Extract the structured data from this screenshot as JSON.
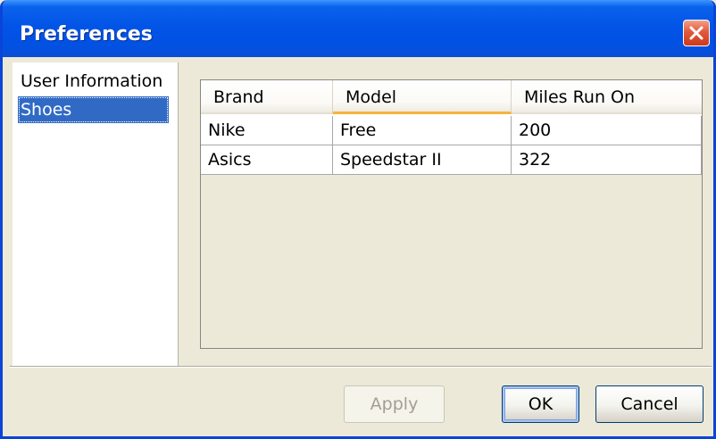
{
  "window": {
    "title": "Preferences",
    "close_icon": "close-icon"
  },
  "sidebar": {
    "items": [
      {
        "label": "User Information",
        "selected": false
      },
      {
        "label": "Shoes",
        "selected": true
      }
    ]
  },
  "table": {
    "columns": [
      "Brand",
      "Model",
      "Miles Run On"
    ],
    "sorted_column": "Model",
    "rows": [
      [
        "Nike",
        "Free",
        "200"
      ],
      [
        "Asics",
        "Speedstar II",
        "322"
      ]
    ]
  },
  "buttons": {
    "apply_label": "Apply",
    "apply_enabled": false,
    "ok_label": "OK",
    "cancel_label": "Cancel"
  },
  "colors": {
    "titlebar_blue": "#0254e6",
    "selection_blue": "#316ac5",
    "close_red": "#e2593b",
    "column_hot_underline": "#f6b43c",
    "dialog_face": "#ece9d8"
  }
}
